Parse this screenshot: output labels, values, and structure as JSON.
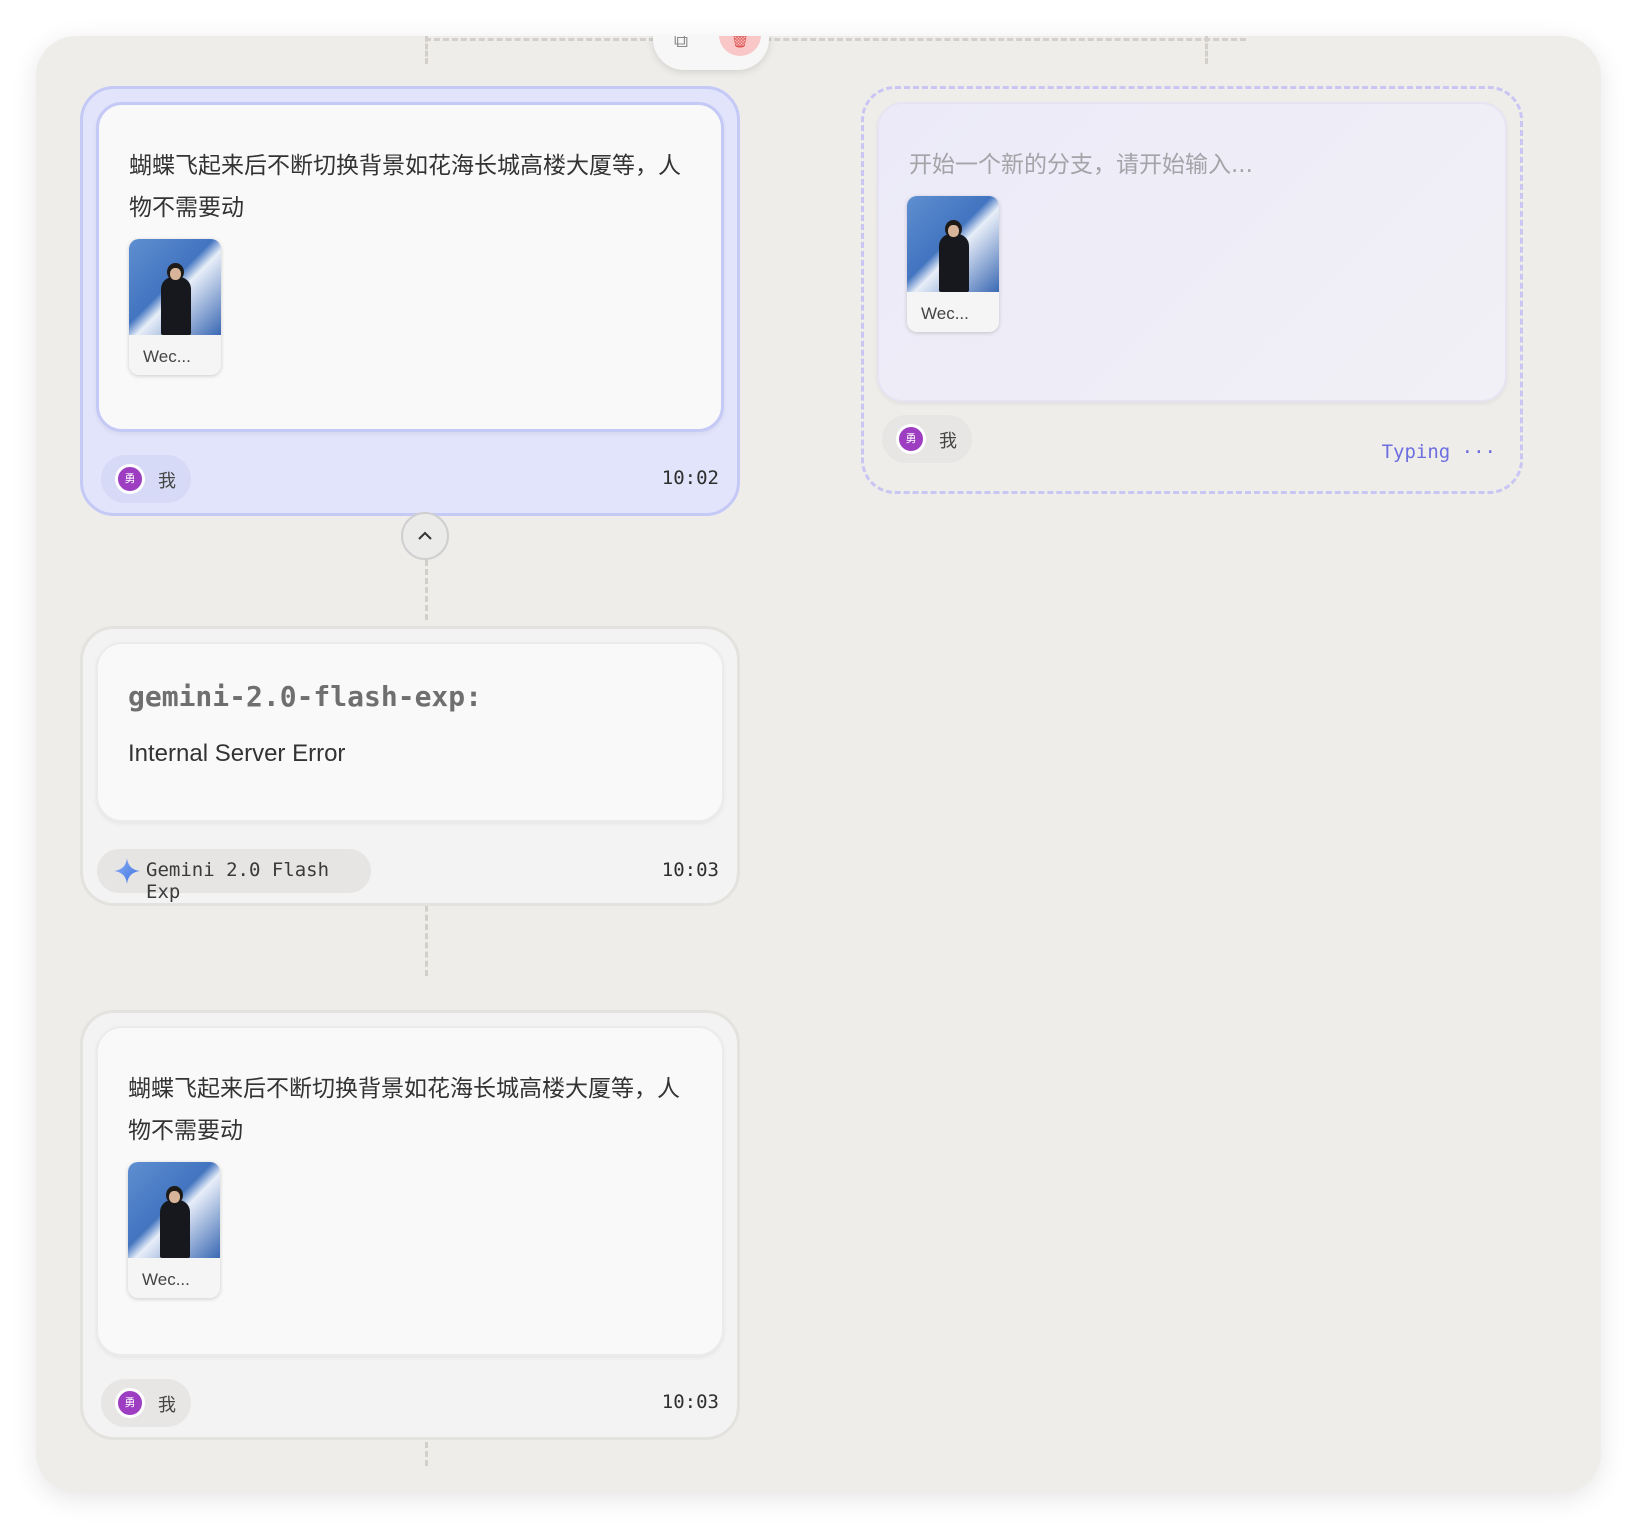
{
  "colors": {
    "canvas_bg": "#efedea",
    "selected_node_bg": "#e1e4fb",
    "selected_border": "#c4c9f6",
    "draft_border": "#c9c6f3",
    "avatar": "#9d3dc2",
    "typing_text": "#6c6ee0",
    "delete_accent": "#f9c7c7"
  },
  "toolbar": {
    "copy_icon": "copy-icon",
    "delete_icon": "trash-icon"
  },
  "nodes": [
    {
      "kind": "user",
      "selected": true,
      "text": "蝴蝶飞起来后不断切换背景如花海长城高楼大厦等，人物不需要动",
      "attachment": {
        "caption": "Wec..."
      },
      "author": {
        "avatar_char": "勇",
        "name": "我"
      },
      "time": "10:02",
      "collapse_icon": "chevron-up-icon"
    },
    {
      "kind": "assistant",
      "model_id": "gemini-2.0-flash-exp:",
      "message": "Internal Server Error",
      "model_name": "Gemini 2.0 Flash Exp",
      "model_icon": "gemini-sparkle-icon",
      "time": "10:03"
    },
    {
      "kind": "user",
      "text": "蝴蝶飞起来后不断切换背景如花海长城高楼大厦等，人物不需要动",
      "attachment": {
        "caption": "Wec..."
      },
      "author": {
        "avatar_char": "勇",
        "name": "我"
      },
      "time": "10:03"
    }
  ],
  "draft": {
    "placeholder": "开始一个新的分支，请开始输入...",
    "attachment": {
      "caption": "Wec..."
    },
    "author": {
      "avatar_char": "勇",
      "name": "我"
    },
    "status": "Typing ···"
  }
}
